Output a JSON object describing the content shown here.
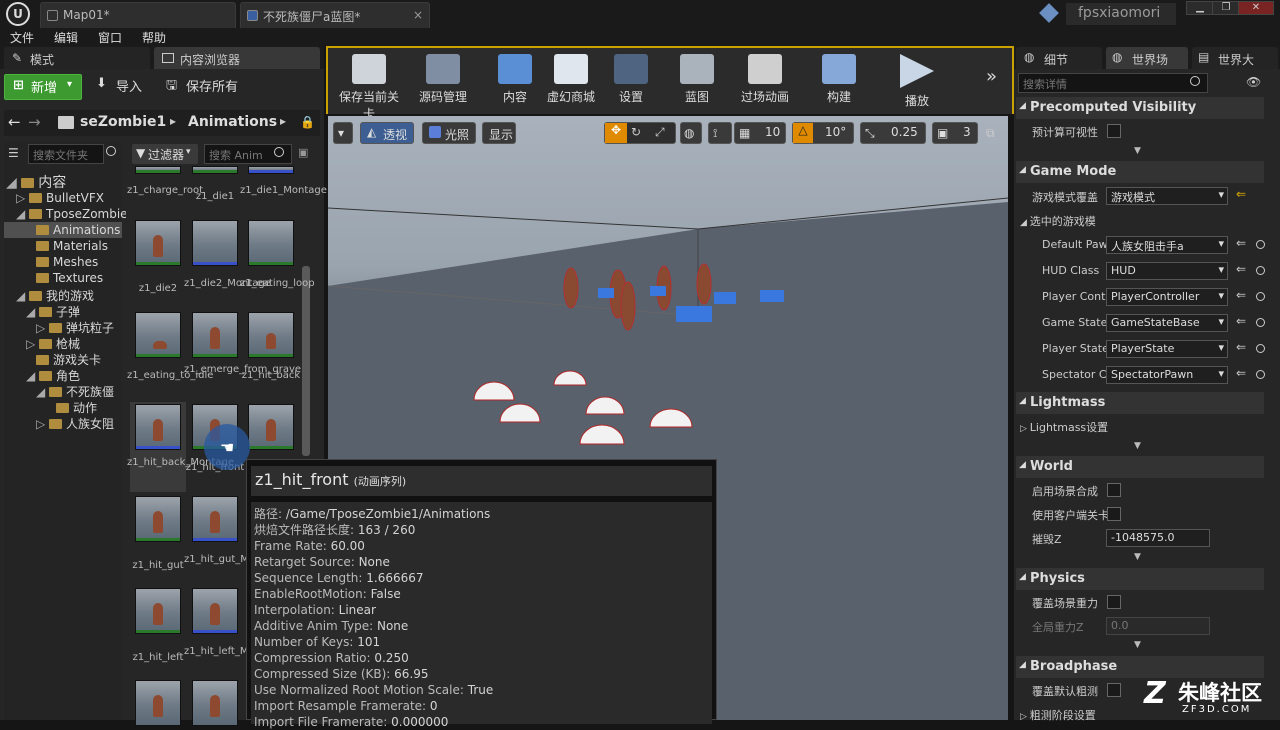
{
  "title_tabs": [
    {
      "label": "Map01*"
    },
    {
      "label": "不死族僵尸a蓝图*"
    }
  ],
  "user": "fpsxiaomori",
  "menu": [
    "文件",
    "编辑",
    "窗口",
    "帮助"
  ],
  "left_tabs": {
    "modes": "模式",
    "content_browser": "内容浏览器"
  },
  "toolbar_left": {
    "add_new": "新增",
    "import": "导入",
    "save_all": "保存所有"
  },
  "path": {
    "folder": "seZombie1",
    "sub": "Animations"
  },
  "search": {
    "folders": "搜索文件夹",
    "assets": "搜索 Anim",
    "filters": "过滤器"
  },
  "tree": [
    {
      "label": "内容"
    },
    {
      "label": "BulletVFX"
    },
    {
      "label": "TposeZombie"
    },
    {
      "label": "Animations"
    },
    {
      "label": "Materials"
    },
    {
      "label": "Meshes"
    },
    {
      "label": "Textures"
    },
    {
      "label": "我的游戏"
    },
    {
      "label": "子弹"
    },
    {
      "label": "弹坑粒子"
    },
    {
      "label": "枪械"
    },
    {
      "label": "游戏关卡"
    },
    {
      "label": "角色"
    },
    {
      "label": "不死族僵"
    },
    {
      "label": "动作"
    },
    {
      "label": "人族女阻"
    }
  ],
  "assets": [
    {
      "label": "z1_charge_root"
    },
    {
      "label": "z1_die1"
    },
    {
      "label": "z1_die1_Montage"
    },
    {
      "label": "z1_die2"
    },
    {
      "label": "z1_die2_Montage"
    },
    {
      "label": "z1_eating_loop"
    },
    {
      "label": "z1_eating_to_idle"
    },
    {
      "label": "z1_emerge_from_grave"
    },
    {
      "label": "z1_hit_back"
    },
    {
      "label": "z1_hit_back_Montage"
    },
    {
      "label": "z1_hit_front"
    },
    {
      "label": ""
    },
    {
      "label": "z1_hit_gut"
    },
    {
      "label": "z1_hit_gut_Montage"
    },
    {
      "label": "z1_hit_left"
    },
    {
      "label": "z1_hit_left_Montage"
    }
  ],
  "main_toolbar": [
    {
      "label": "保存当前关卡"
    },
    {
      "label": "源码管理"
    },
    {
      "label": "内容"
    },
    {
      "label": "虚幻商城"
    },
    {
      "label": "设置"
    },
    {
      "label": "蓝图"
    },
    {
      "label": "过场动画"
    },
    {
      "label": "构建"
    },
    {
      "label": "播放"
    }
  ],
  "viewport": {
    "perspective": "透视",
    "lit": "光照",
    "show": "显示",
    "grid": "10",
    "angle": "10°",
    "scale": "0.25",
    "speed": "3"
  },
  "right_tabs": {
    "details": "细节",
    "world": "世界场",
    "world2": "世界大"
  },
  "details_search": "搜索详情",
  "details": {
    "precomputed": {
      "header": "Precomputed Visibility",
      "label": "预计算可视性"
    },
    "game_mode": {
      "header": "Game Mode",
      "override_label": "游戏模式覆盖",
      "override_value": "游戏模式",
      "selected_label": "选中的游戏模",
      "rows": [
        {
          "label": "Default Paw",
          "value": "人族女阻击手a"
        },
        {
          "label": "HUD Class",
          "value": "HUD"
        },
        {
          "label": "Player Cont",
          "value": "PlayerController"
        },
        {
          "label": "Game State",
          "value": "GameStateBase"
        },
        {
          "label": "Player State",
          "value": "PlayerState"
        },
        {
          "label": "Spectator C",
          "value": "SpectatorPawn"
        }
      ]
    },
    "lightmass": {
      "header": "Lightmass",
      "label": "Lightmass设置"
    },
    "world": {
      "header": "World",
      "enable_composition": "启用场景合成",
      "client_nav": "使用客户端关卡",
      "kill_z": "摧毁Z",
      "kill_z_value": "-1048575.0"
    },
    "physics": {
      "header": "Physics",
      "override_gravity": "覆盖场景重力",
      "global_gravity": "全局重力Z",
      "global_gravity_value": "0.0"
    },
    "broadphase": {
      "header": "Broadphase",
      "override": "覆盖默认粗测",
      "settings": "粗测阶段设置"
    }
  },
  "tooltip": {
    "title": "z1_hit_front",
    "subtitle": "(动画序列)",
    "rows": [
      {
        "k": "路径: ",
        "v": "/Game/TposeZombie1/Animations"
      },
      {
        "k": "烘焙文件路径长度: ",
        "v": "163 / 260"
      },
      {
        "k": "Frame Rate: ",
        "v": "60.00"
      },
      {
        "k": "Retarget Source: ",
        "v": "None"
      },
      {
        "k": "Sequence Length: ",
        "v": "1.666667"
      },
      {
        "k": "EnableRootMotion: ",
        "v": "False"
      },
      {
        "k": "Interpolation: ",
        "v": "Linear"
      },
      {
        "k": "Additive Anim Type: ",
        "v": "None"
      },
      {
        "k": "Number of Keys: ",
        "v": "101"
      },
      {
        "k": "Compression Ratio: ",
        "v": "0.250"
      },
      {
        "k": "Compressed Size (KB): ",
        "v": "66.95"
      },
      {
        "k": "Use Normalized Root Motion Scale: ",
        "v": "True"
      },
      {
        "k": "Import Resample Framerate: ",
        "v": "0"
      },
      {
        "k": "Import File Framerate: ",
        "v": "0.000000"
      }
    ]
  },
  "watermark": {
    "brand": "朱峰社区",
    "url": "ZF3D.COM"
  }
}
